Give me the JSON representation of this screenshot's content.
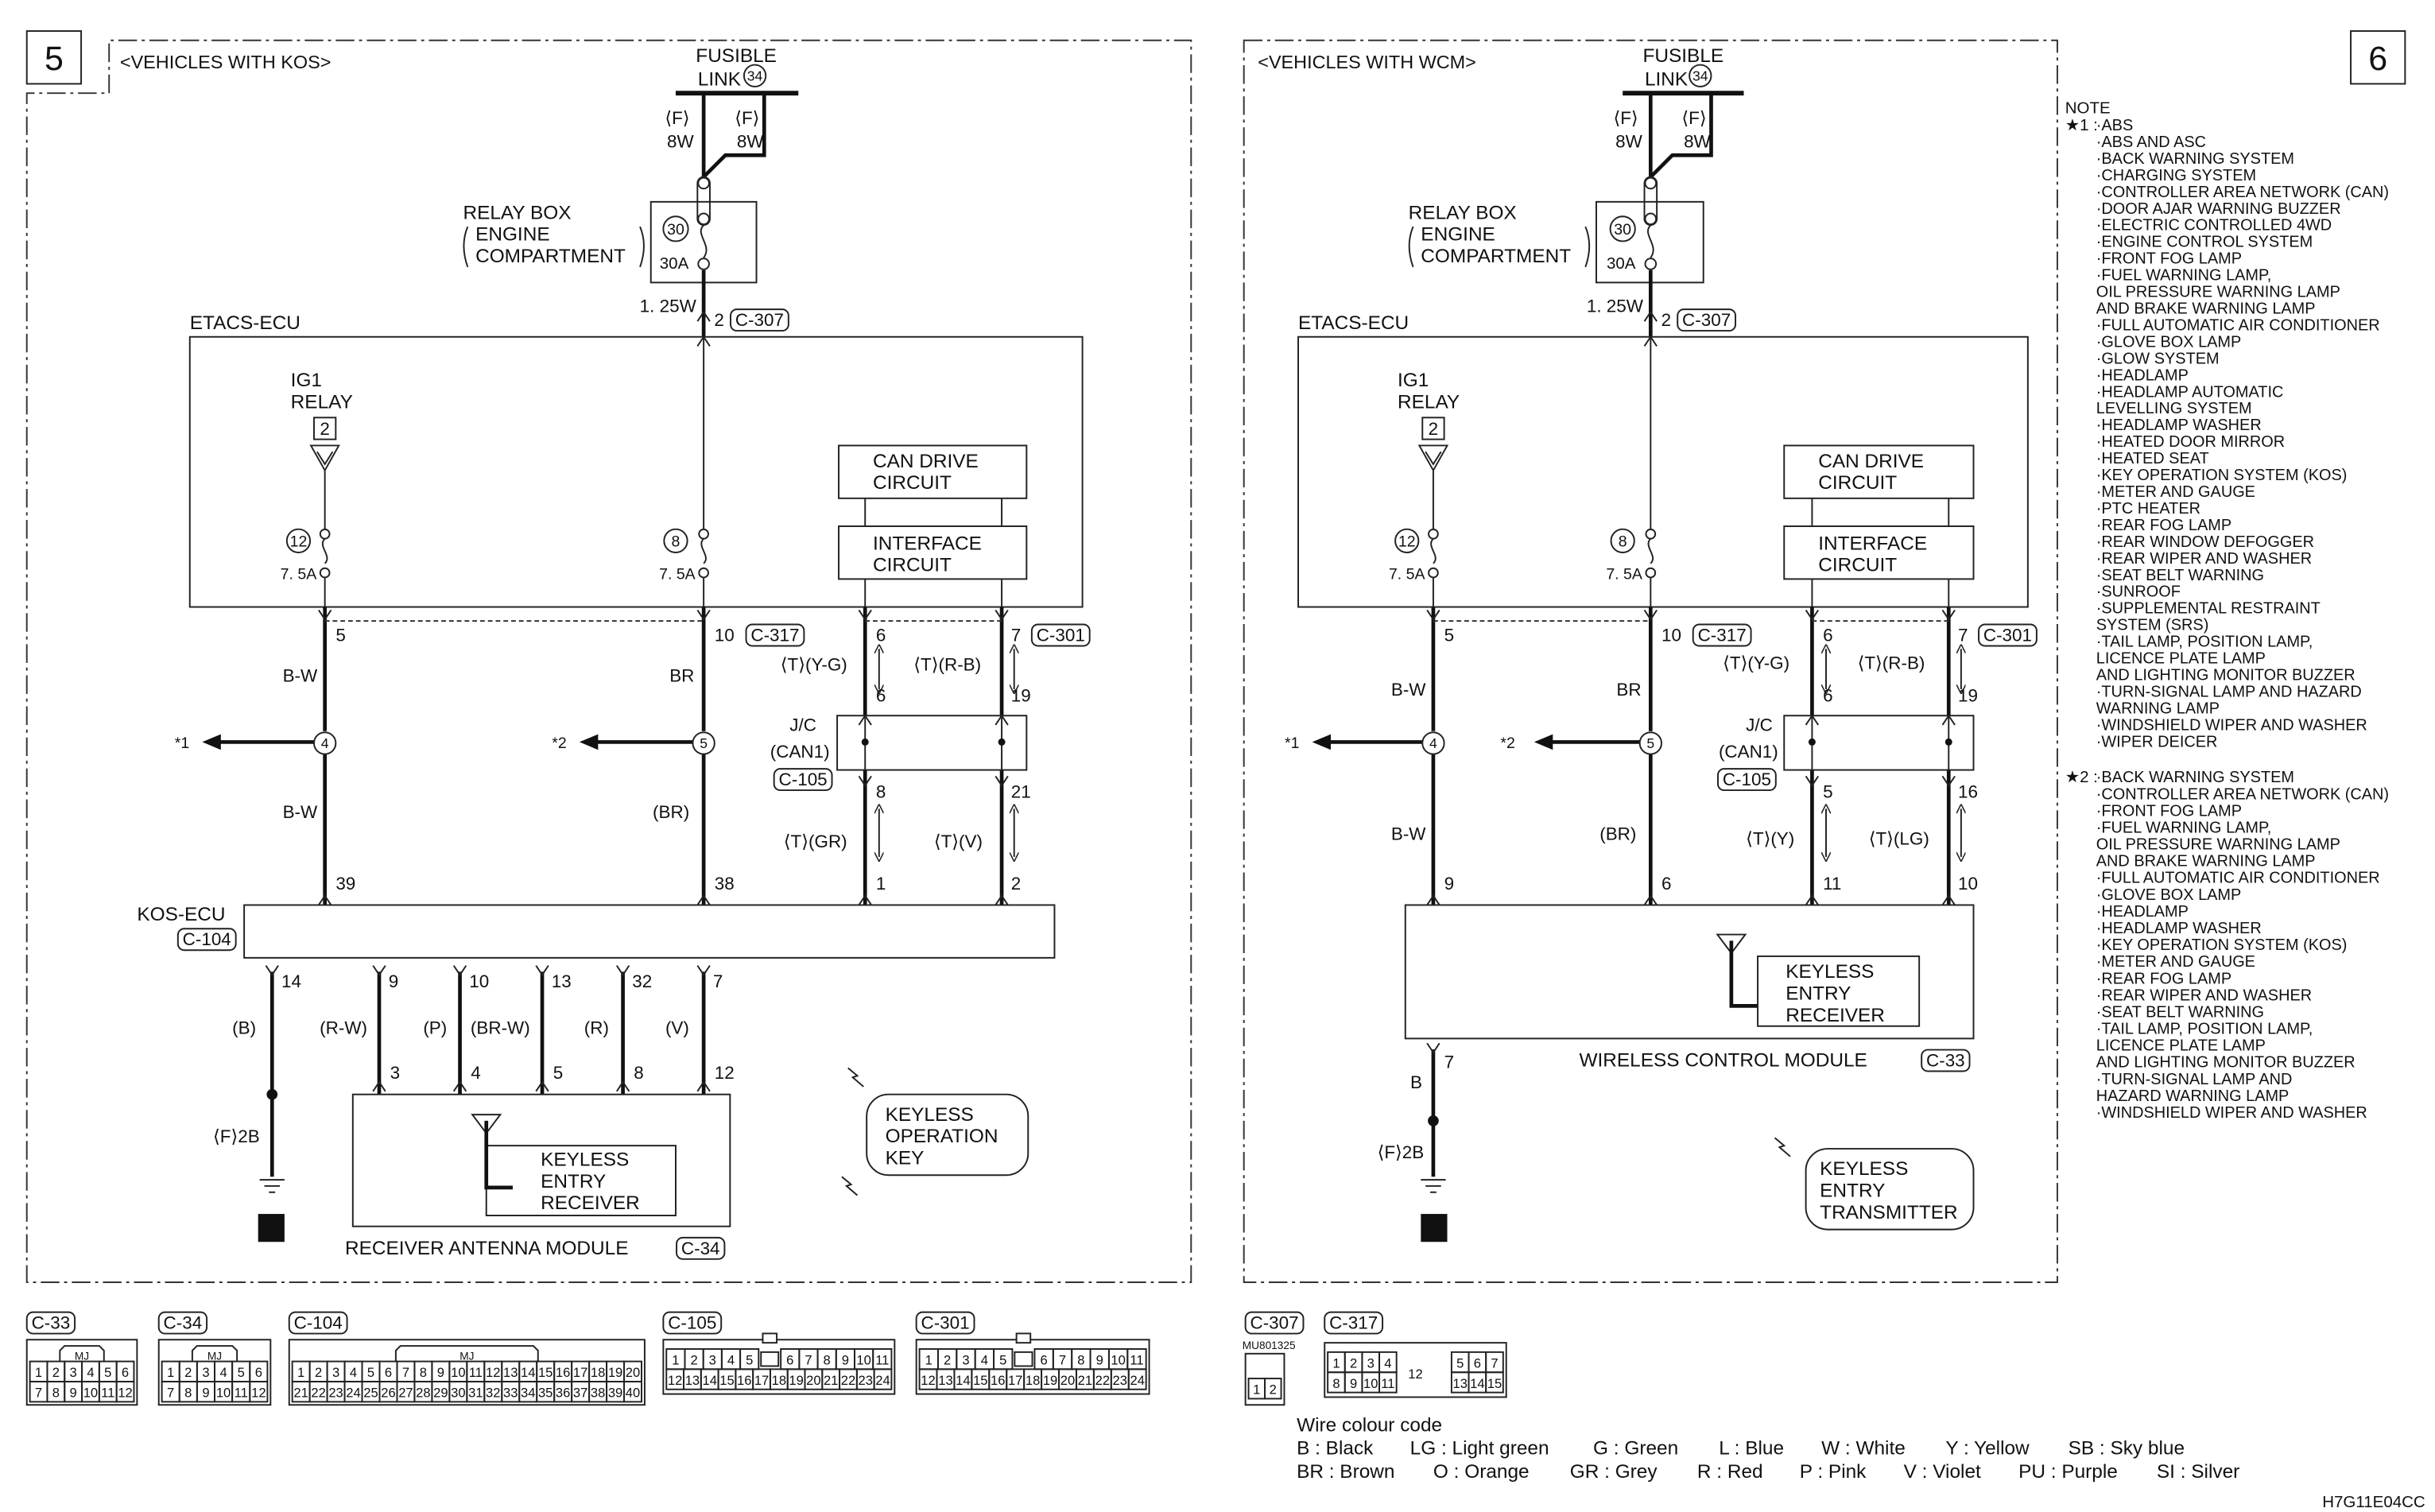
{
  "left": {
    "page_number": "5",
    "variant": "<VEHICLES WITH KOS>",
    "fusible_link": {
      "line1": "FUSIBLE",
      "line2": "LINK",
      "number": "34"
    },
    "fuse_wires": [
      {
        "connector": "⟨F⟩",
        "size": "8W"
      },
      {
        "connector": "⟨F⟩",
        "size": "8W"
      }
    ],
    "relay_box": {
      "line1": "RELAY BOX",
      "line2": "ENGINE",
      "line3": "COMPARTMENT",
      "fuse_number": "30",
      "fuse_rating": "30A"
    },
    "supply_wire": "1. 25W",
    "supply_pin": "2",
    "supply_connector": "C-307",
    "etacs": "ETACS-ECU",
    "ig1": {
      "line1": "IG1",
      "line2": "RELAY",
      "terminal": "2"
    },
    "fuse_ig1": {
      "number": "12",
      "rating": "7. 5A"
    },
    "fuse_b": {
      "number": "8",
      "rating": "7. 5A"
    },
    "can_drive": {
      "line1": "CAN DRIVE",
      "line2": "CIRCUIT"
    },
    "interface": {
      "line1": "INTERFACE",
      "line2": "CIRCUIT"
    },
    "etacs_pins": {
      "ig1": "5",
      "batt": "10",
      "batt_connector": "C-317",
      "can_h": "6",
      "can_l": "7",
      "can_connector": "C-301"
    },
    "wire_ig1_upper": "B-W",
    "wire_batt_upper": "BR",
    "can_upper": {
      "h": "⟨T⟩(Y-G)",
      "l": "⟨T⟩(R-B)",
      "h_pin": "6",
      "l_pin": "19"
    },
    "jc": {
      "line1": "J/C",
      "line2": "(CAN1)",
      "connector": "C-105"
    },
    "splice_ig1": "4",
    "splice_batt": "5",
    "ref_ig1": "*1",
    "ref_batt": "*2",
    "can_lower": {
      "h_pin": "8",
      "l_pin": "21",
      "h": "⟨T⟩(GR)",
      "l": "⟨T⟩(V)"
    },
    "wire_ig1_lower": "B-W",
    "wire_batt_lower": "(BR)",
    "ecu_pins": {
      "ig1": "39",
      "batt": "38",
      "can_h": "1",
      "can_l": "2"
    },
    "module": {
      "name": "KOS-ECU",
      "connector": "C-104"
    },
    "output_pins": [
      {
        "pin": "14",
        "wire": "(B)"
      },
      {
        "pin": "9",
        "wire": "(R-W)",
        "dest": "3"
      },
      {
        "pin": "10",
        "wire": "(P)",
        "dest": "4"
      },
      {
        "pin": "13",
        "wire": "(BR-W)",
        "dest": "5"
      },
      {
        "pin": "32",
        "wire": "(R)",
        "dest": "8"
      },
      {
        "pin": "7",
        "wire": "(V)",
        "dest": "12"
      }
    ],
    "ground": {
      "wire": "⟨F⟩2B",
      "number": "2"
    },
    "antenna_module": {
      "name": "RECEIVER ANTENNA MODULE",
      "connector": "C-34",
      "receiver": [
        "KEYLESS",
        "ENTRY",
        "RECEIVER"
      ]
    },
    "key": [
      "KEYLESS",
      "OPERATION",
      "KEY"
    ]
  },
  "right": {
    "page_number": "6",
    "variant": "<VEHICLES WITH WCM>",
    "fusible_link": {
      "line1": "FUSIBLE",
      "line2": "LINK",
      "number": "34"
    },
    "fuse_wires": [
      {
        "connector": "⟨F⟩",
        "size": "8W"
      },
      {
        "connector": "⟨F⟩",
        "size": "8W"
      }
    ],
    "relay_box": {
      "line1": "RELAY BOX",
      "line2": "ENGINE",
      "line3": "COMPARTMENT",
      "fuse_number": "30",
      "fuse_rating": "30A"
    },
    "supply_wire": "1. 25W",
    "supply_pin": "2",
    "supply_connector": "C-307",
    "etacs": "ETACS-ECU",
    "ig1": {
      "line1": "IG1",
      "line2": "RELAY",
      "terminal": "2"
    },
    "fuse_ig1": {
      "number": "12",
      "rating": "7. 5A"
    },
    "fuse_b": {
      "number": "8",
      "rating": "7. 5A"
    },
    "can_drive": {
      "line1": "CAN DRIVE",
      "line2": "CIRCUIT"
    },
    "interface": {
      "line1": "INTERFACE",
      "line2": "CIRCUIT"
    },
    "etacs_pins": {
      "ig1": "5",
      "batt": "10",
      "batt_connector": "C-317",
      "can_h": "6",
      "can_l": "7",
      "can_connector": "C-301"
    },
    "wire_ig1_upper": "B-W",
    "wire_batt_upper": "BR",
    "can_upper": {
      "h": "⟨T⟩(Y-G)",
      "l": "⟨T⟩(R-B)",
      "h_pin": "6",
      "l_pin": "19"
    },
    "jc": {
      "line1": "J/C",
      "line2": "(CAN1)",
      "connector": "C-105"
    },
    "splice_ig1": "4",
    "splice_batt": "5",
    "ref_ig1": "*1",
    "ref_batt": "*2",
    "can_lower": {
      "h_pin": "5",
      "l_pin": "16",
      "h": "⟨T⟩(Y)",
      "l": "⟨T⟩(LG)"
    },
    "wire_ig1_lower": "B-W",
    "wire_batt_lower": "(BR)",
    "ecu_pins": {
      "ig1": "9",
      "batt": "6",
      "can_h": "11",
      "can_l": "10"
    },
    "module": {
      "name": "WIRELESS CONTROL MODULE",
      "connector": "C-33",
      "receiver": [
        "KEYLESS",
        "ENTRY",
        "RECEIVER"
      ]
    },
    "ground": {
      "pin": "7",
      "pin_wire": "B",
      "wire": "⟨F⟩2B",
      "number": "2"
    },
    "transmitter": [
      "KEYLESS",
      "ENTRY",
      "TRANSMITTER"
    ]
  },
  "note": {
    "title": "NOTE",
    "groups": [
      {
        "label": "★1 :",
        "lines": [
          "·ABS",
          "·ABS AND ASC",
          "·BACK WARNING SYSTEM",
          "·CHARGING SYSTEM",
          "·CONTROLLER AREA NETWORK (CAN)",
          "·DOOR AJAR WARNING BUZZER",
          "·ELECTRIC CONTROLLED 4WD",
          "·ENGINE CONTROL SYSTEM",
          "·FRONT FOG LAMP",
          "·FUEL WARNING LAMP,",
          " OIL PRESSURE WARNING LAMP",
          " AND BRAKE WARNING LAMP",
          "·FULL AUTOMATIC AIR CONDITIONER",
          "·GLOVE BOX LAMP",
          "·GLOW SYSTEM",
          "·HEADLAMP",
          "·HEADLAMP AUTOMATIC",
          " LEVELLING SYSTEM",
          "·HEADLAMP WASHER",
          "·HEATED DOOR MIRROR",
          "·HEATED SEAT",
          "·KEY OPERATION SYSTEM (KOS)",
          "·METER AND GAUGE",
          "·PTC HEATER",
          "·REAR FOG LAMP",
          "·REAR WINDOW DEFOGGER",
          "·REAR WIPER AND WASHER",
          "·SEAT BELT WARNING",
          "·SUNROOF",
          "·SUPPLEMENTAL RESTRAINT",
          " SYSTEM (SRS)",
          "·TAIL LAMP, POSITION LAMP,",
          " LICENCE PLATE LAMP",
          " AND LIGHTING MONITOR BUZZER",
          "·TURN-SIGNAL LAMP AND HAZARD",
          " WARNING LAMP",
          "·WINDSHIELD WIPER AND WASHER",
          "·WIPER DEICER"
        ]
      },
      {
        "label": "★2 :",
        "lines": [
          "·BACK WARNING SYSTEM",
          "·CONTROLLER AREA NETWORK (CAN)",
          "·FRONT FOG LAMP",
          "·FUEL WARNING LAMP,",
          " OIL PRESSURE WARNING LAMP",
          " AND BRAKE WARNING LAMP",
          "·FULL AUTOMATIC AIR CONDITIONER",
          "·GLOVE BOX LAMP",
          "·HEADLAMP",
          "·HEADLAMP WASHER",
          "·KEY OPERATION SYSTEM (KOS)",
          "·METER AND GAUGE",
          "·REAR FOG LAMP",
          "·REAR WIPER AND WASHER",
          "·SEAT BELT WARNING",
          "·TAIL LAMP, POSITION LAMP,",
          " LICENCE PLATE LAMP",
          " AND LIGHTING MONITOR BUZZER",
          "·TURN-SIGNAL LAMP AND",
          " HAZARD WARNING LAMP",
          "·WINDSHIELD WIPER AND WASHER"
        ]
      }
    ]
  },
  "connectors": [
    {
      "name": "C-33",
      "header": "MJ",
      "rows": [
        [
          "1",
          "2",
          "3",
          "4",
          "5",
          "6"
        ],
        [
          "7",
          "8",
          "9",
          "10",
          "11",
          "12"
        ]
      ]
    },
    {
      "name": "C-34",
      "header": "MJ",
      "rows": [
        [
          "1",
          "2",
          "3",
          "4",
          "5",
          "6"
        ],
        [
          "7",
          "8",
          "9",
          "10",
          "11",
          "12"
        ]
      ]
    },
    {
      "name": "C-104",
      "header": "MJ",
      "rows": [
        [
          "1",
          "2",
          "3",
          "4",
          "5",
          "6",
          "7",
          "8",
          "9",
          "10",
          "11",
          "12",
          "13",
          "14",
          "15",
          "16",
          "17",
          "18",
          "19",
          "20"
        ],
        [
          "21",
          "22",
          "23",
          "24",
          "25",
          "26",
          "27",
          "28",
          "29",
          "30",
          "31",
          "32",
          "33",
          "34",
          "35",
          "36",
          "37",
          "38",
          "39",
          "40"
        ]
      ]
    },
    {
      "name": "C-105",
      "rows": [
        [
          "1",
          "2",
          "3",
          "4",
          "5",
          null,
          "6",
          "7",
          "8",
          "9",
          "10",
          "11"
        ],
        [
          "12",
          "13",
          "14",
          "15",
          "16",
          "17",
          "18",
          "19",
          "20",
          "21",
          "22",
          "23",
          "24"
        ]
      ]
    },
    {
      "name": "C-301",
      "rows": [
        [
          "1",
          "2",
          "3",
          "4",
          "5",
          null,
          "6",
          "7",
          "8",
          "9",
          "10",
          "11"
        ],
        [
          "12",
          "13",
          "14",
          "15",
          "16",
          "17",
          "18",
          "19",
          "20",
          "21",
          "22",
          "23",
          "24"
        ]
      ]
    },
    {
      "name": "C-307",
      "part_number": "MU801325",
      "rows": [
        [
          "1",
          "2"
        ]
      ]
    },
    {
      "name": "C-317",
      "rows": [
        [
          "1",
          "2",
          "3",
          "4",
          null,
          "5",
          "6",
          "7"
        ],
        [
          "8",
          "9",
          "10",
          "11",
          null,
          "13",
          "14",
          "15"
        ]
      ],
      "center_pin": "12"
    }
  ],
  "wire_colour_code": {
    "title": "Wire colour code",
    "rows": [
      [
        "B : Black",
        "LG : Light green",
        "G : Green",
        "L : Blue",
        "W : White",
        "Y : Yellow",
        "SB : Sky blue"
      ],
      [
        "BR : Brown",
        "O : Orange",
        "GR : Grey",
        "R : Red",
        "P : Pink",
        "V : Violet",
        "PU : Purple",
        "SI : Silver"
      ]
    ]
  },
  "figure_code": "H7G11E04CC"
}
